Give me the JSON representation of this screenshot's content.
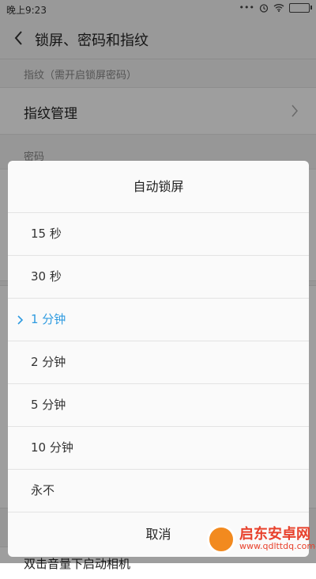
{
  "status_bar": {
    "time": "晚上9:23",
    "icons": [
      "dots-icon",
      "alarm-icon",
      "wifi-icon",
      "battery-icon"
    ],
    "dots": "•••"
  },
  "header": {
    "title": "锁屏、密码和指纹"
  },
  "settings": {
    "fingerprint_section": "指纹（需开启锁屏密码）",
    "fingerprint_manage": "指纹管理",
    "password_section": "密码",
    "bottom_partial": "双击音量下启动相机"
  },
  "dialog": {
    "title": "自动锁屏",
    "options": [
      "15 秒",
      "30 秒",
      "1 分钟",
      "2 分钟",
      "5 分钟",
      "10 分钟",
      "永不"
    ],
    "selected": "1 分钟",
    "cancel": "取消"
  },
  "colors": {
    "accent": "#2f9be0",
    "overlay": "rgba(0,0,0,0.38)"
  },
  "watermark": {
    "main": "启东安卓网",
    "sub": "www.qdlttdq.com"
  }
}
